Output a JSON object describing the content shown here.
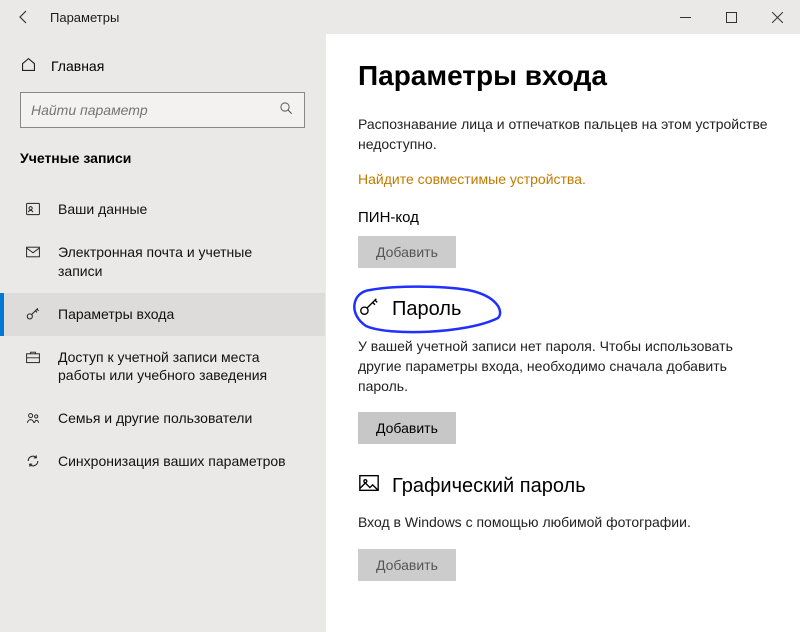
{
  "titlebar": {
    "title": "Параметры"
  },
  "sidebar": {
    "home_label": "Главная",
    "search_placeholder": "Найти параметр",
    "section_title": "Учетные записи",
    "items": [
      {
        "label": "Ваши данные"
      },
      {
        "label": "Электронная почта и учетные записи"
      },
      {
        "label": "Параметры входа"
      },
      {
        "label": "Доступ к учетной записи места работы или учебного заведения"
      },
      {
        "label": "Семья и другие пользователи"
      },
      {
        "label": "Синхронизация ваших параметров"
      }
    ]
  },
  "content": {
    "heading": "Параметры входа",
    "intro_text": "Распознавание лица и отпечатков пальцев на этом устройстве недоступно.",
    "compat_link": "Найдите совместимые устройства.",
    "pin_label": "ПИН-код",
    "pin_button": "Добавить",
    "password_title": "Пароль",
    "password_desc": "У вашей учетной записи нет пароля. Чтобы использовать другие параметры входа, необходимо сначала добавить пароль.",
    "password_button": "Добавить",
    "picture_title": "Графический пароль",
    "picture_desc": "Вход в Windows с помощью любимой фотографии.",
    "picture_button": "Добавить"
  }
}
